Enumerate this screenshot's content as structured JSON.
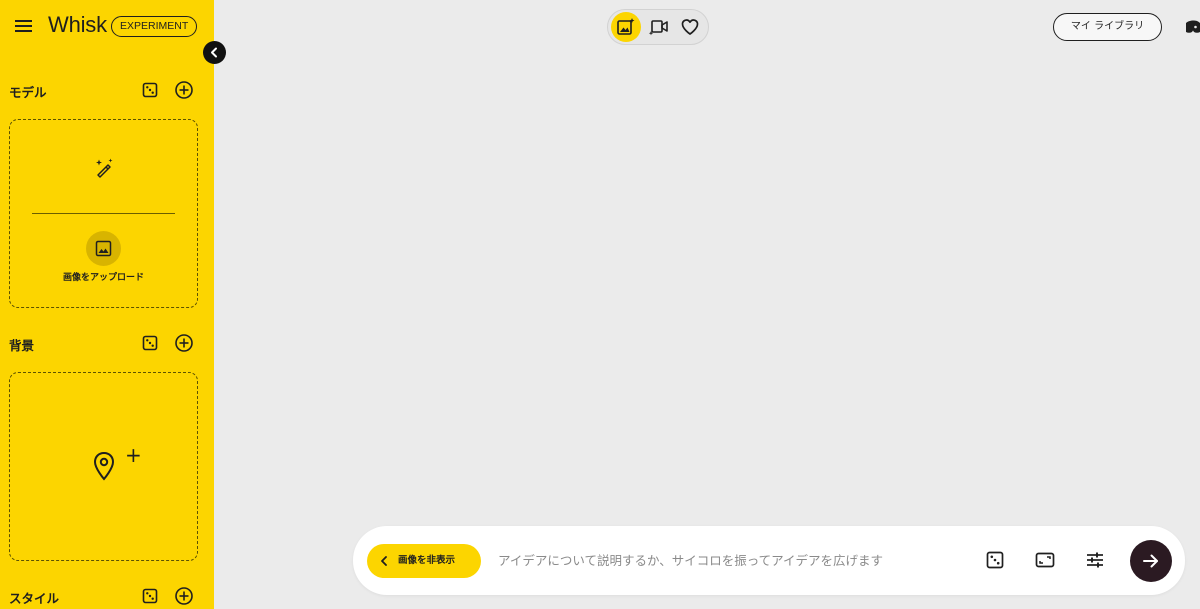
{
  "sidebar": {
    "app_title": "Whisk",
    "badge": "EXPERIMENT",
    "sections": {
      "model": {
        "label": "モデル",
        "upload_label": "画像をアップロード"
      },
      "background": {
        "label": "背景"
      },
      "style": {
        "label": "スタイル"
      }
    }
  },
  "top_bar": {
    "modes": [
      "image-create-icon",
      "video-icon",
      "heart-icon"
    ],
    "active_mode": "image-create-icon",
    "library_label": "マイ ライブラリ"
  },
  "prompt_bar": {
    "hide_images_label": "画像を非表示",
    "placeholder": "アイデアについて説明するか、サイコロを振ってアイデアを広げます",
    "value": ""
  },
  "colors": {
    "accent": "#fcd500",
    "background": "#ebebeb",
    "send_button": "#2b1a22",
    "text": "#1f1f1f"
  }
}
